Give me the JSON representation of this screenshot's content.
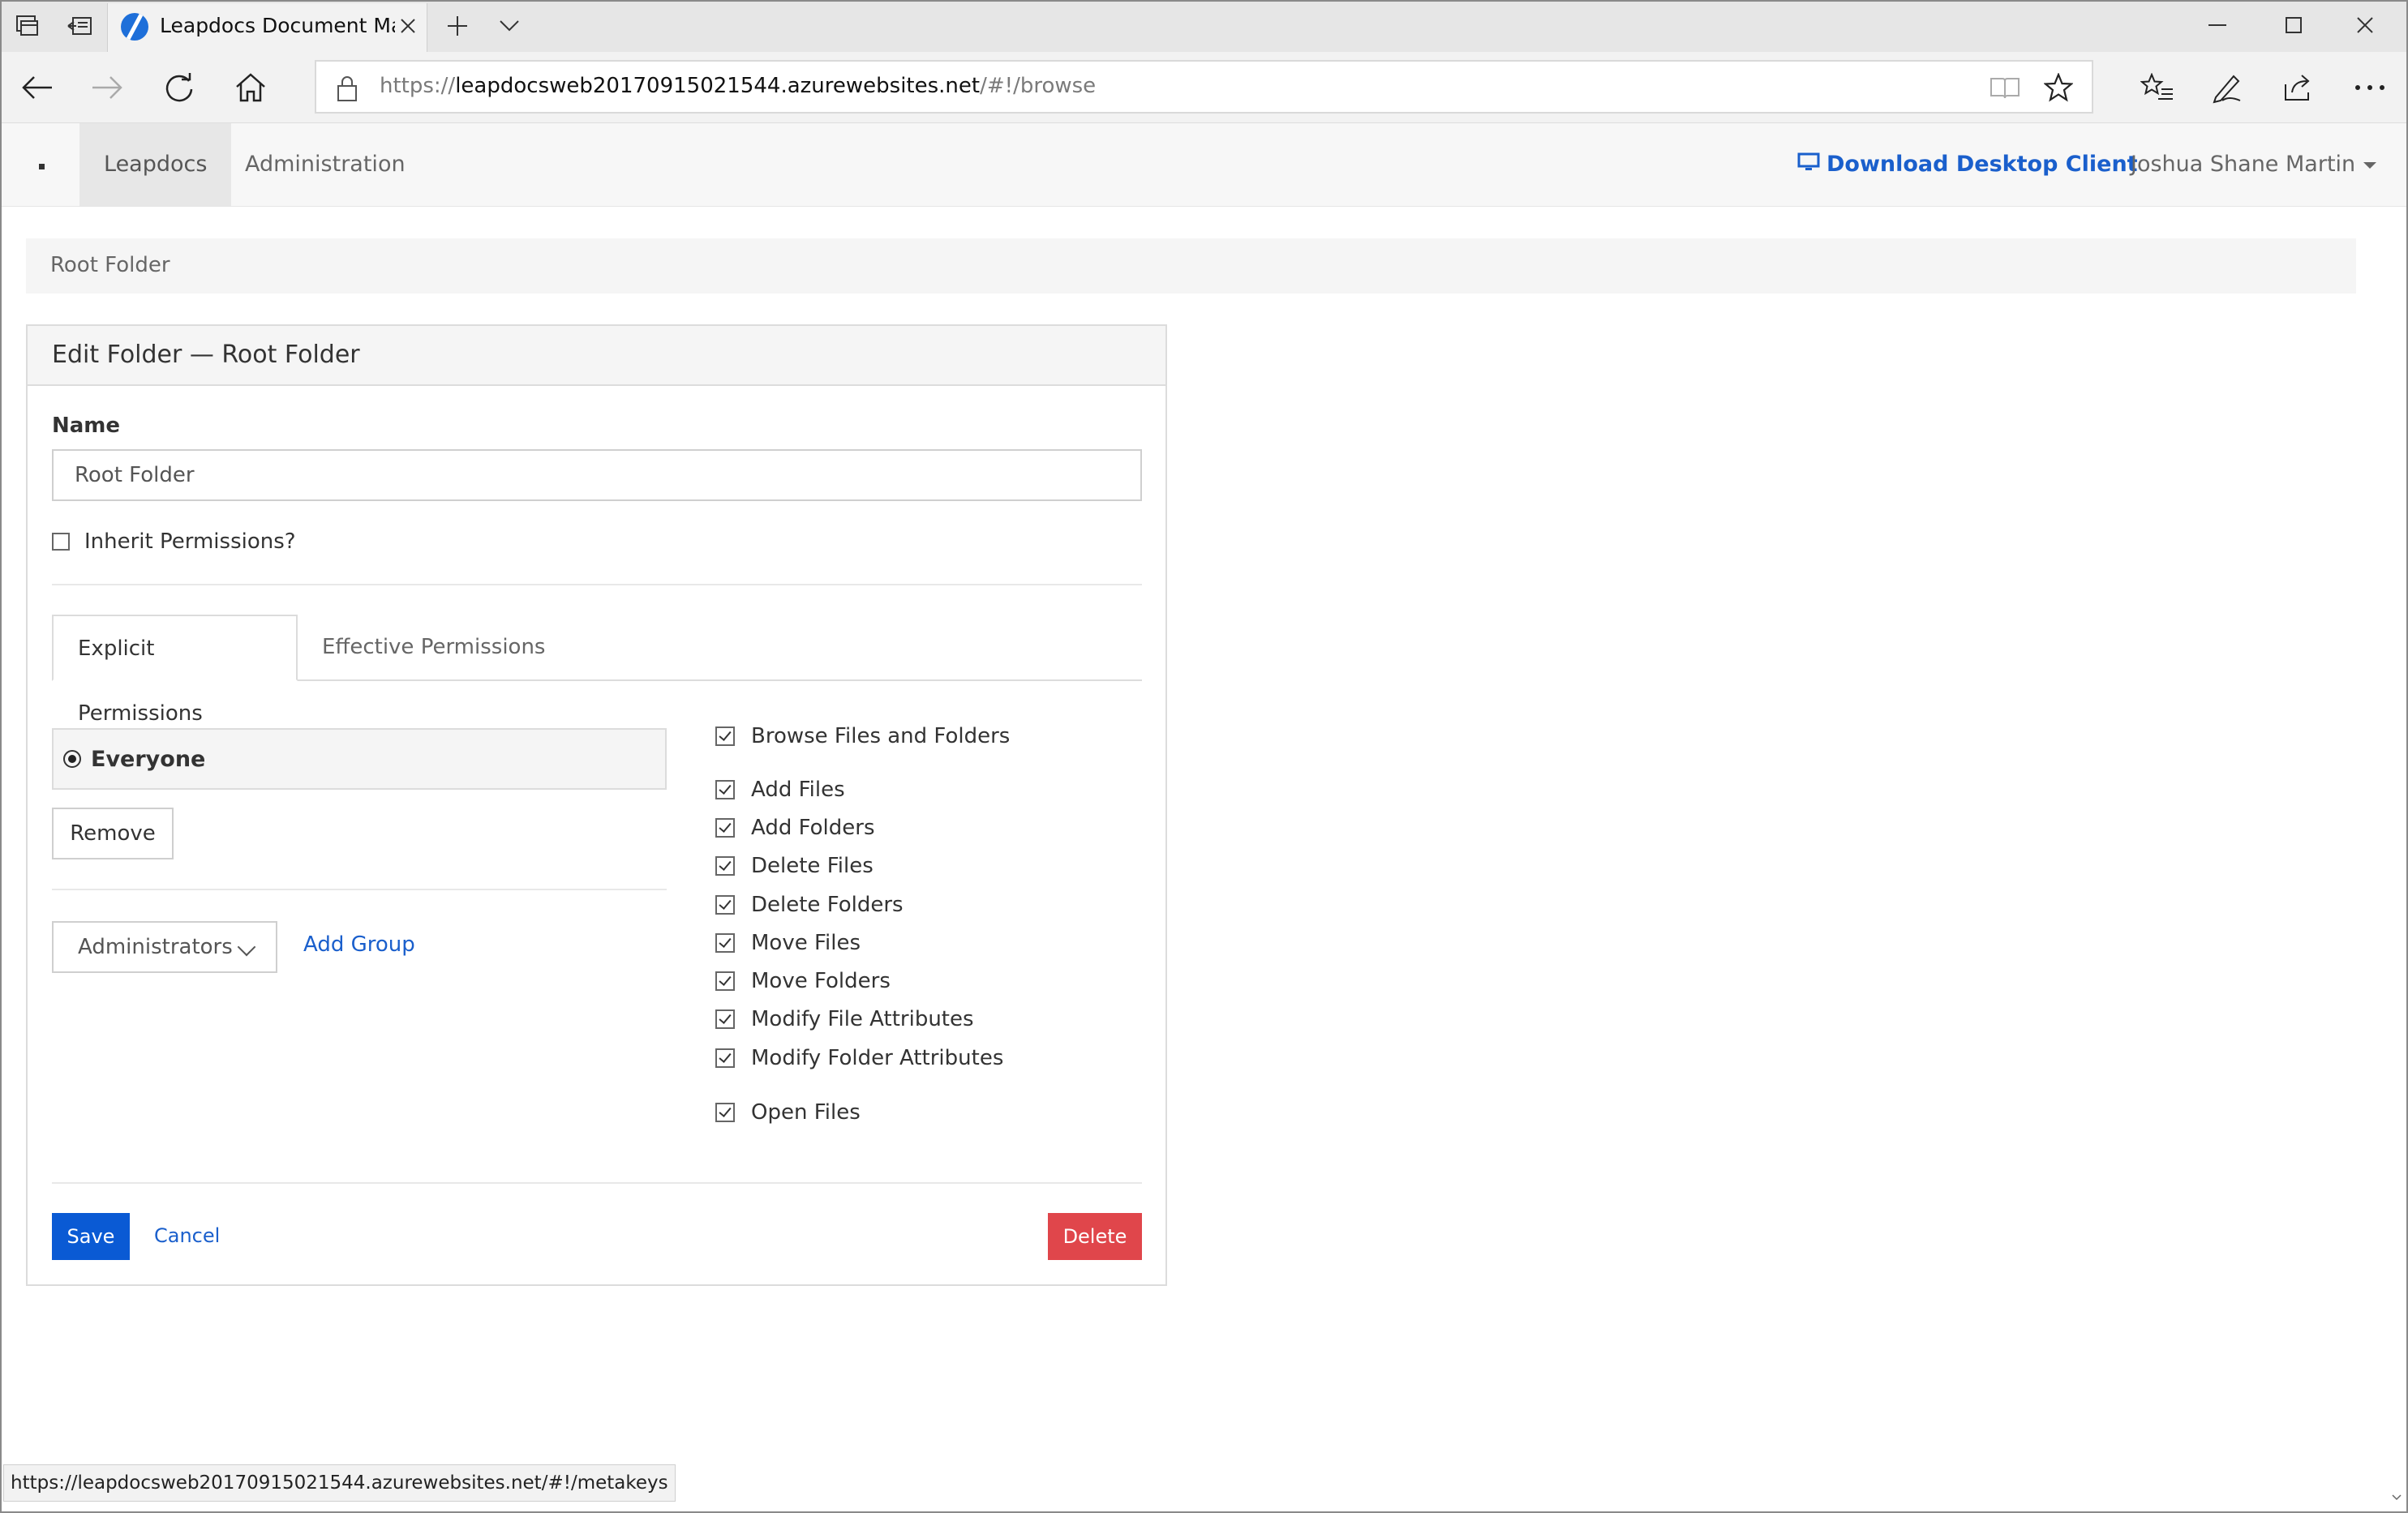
{
  "browser": {
    "tab_title": "Leapdocs Document Ma",
    "url_prefix": "https://",
    "url_host": "leapdocsweb20170915021544.azurewebsites.net",
    "url_path": "/#!/browse",
    "status_url": "https://leapdocsweb20170915021544.azurewebsites.net/#!/metakeys"
  },
  "site": {
    "nav": [
      "Leapdocs",
      "Administration"
    ],
    "download_label": "Download Desktop Client",
    "user_name": "Joshua Shane Martin",
    "colors": {
      "link": "#1a5fcc",
      "primary": "#0a5ad4",
      "danger": "#e0464b"
    }
  },
  "breadcrumb": "Root Folder",
  "panel": {
    "title": "Edit Folder — Root Folder",
    "name_label": "Name",
    "name_value": "Root Folder",
    "inherit_label": "Inherit Permissions?",
    "tabs": [
      "Explicit Permissions",
      "Effective Permissions"
    ],
    "selected_group": "Everyone",
    "remove_label": "Remove",
    "group_select": "Administrators",
    "add_group_label": "Add Group",
    "permissions": [
      "Browse Files and Folders",
      "Add Files",
      "Add Folders",
      "Delete Files",
      "Delete Folders",
      "Move Files",
      "Move Folders",
      "Modify File Attributes",
      "Modify Folder Attributes",
      "Open Files"
    ],
    "save_label": "Save",
    "cancel_label": "Cancel",
    "delete_label": "Delete"
  }
}
